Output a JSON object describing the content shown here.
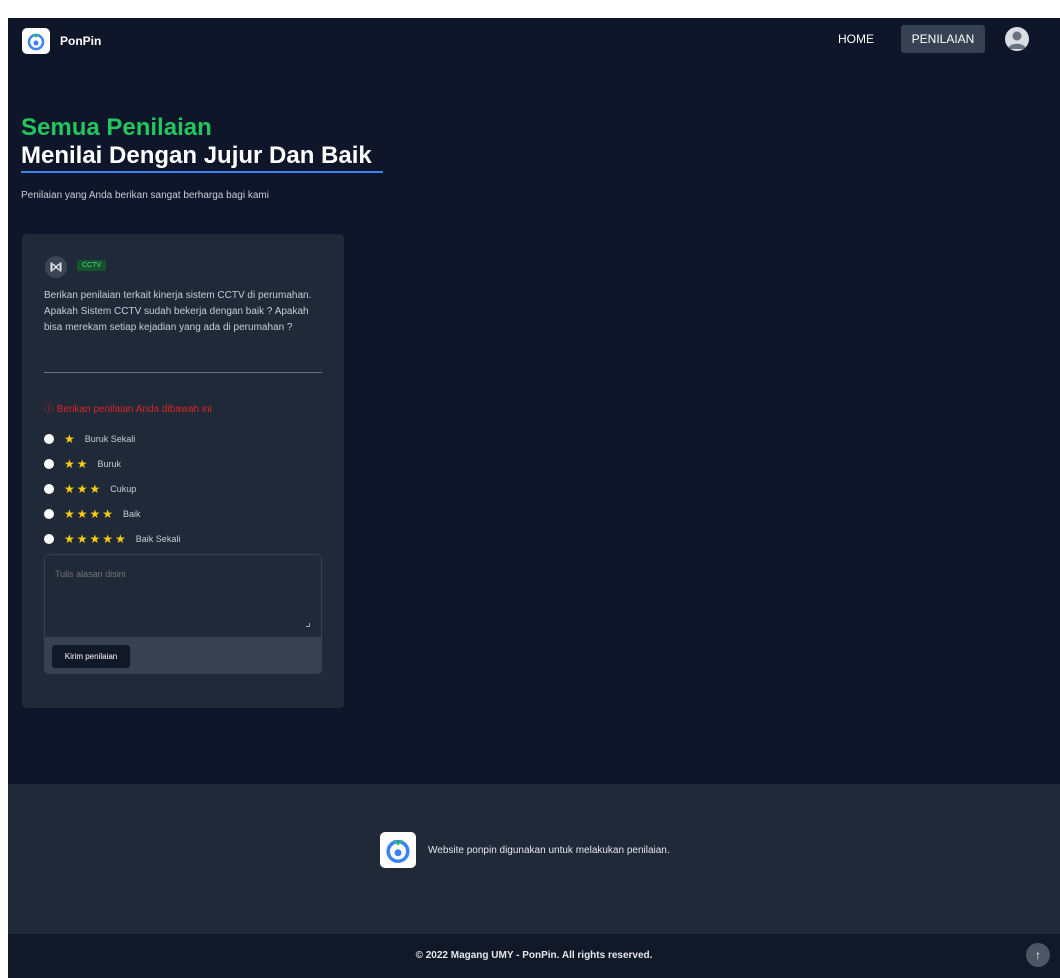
{
  "nav": {
    "brand": "PonPin",
    "home": "HOME",
    "penilaian": "PENILAIAN"
  },
  "hero": {
    "title": "Semua Penilaian",
    "subtitle": "Menilai Dengan Jujur Dan Baik",
    "description": "Penilaian yang Anda berikan sangat berharga bagi kami"
  },
  "card": {
    "badge": "CCTV",
    "question": "Berikan penilaian terkait kinerja sistem CCTV di perumahan. Apakah Sistem CCTV sudah bekerja dengan baik ? Apakah bisa merekam setiap kejadian yang ada di perumahan ?",
    "warning": "ⓘ Berikan penilaian Anda dibawah ini",
    "ratings": [
      {
        "stars": "★",
        "label": "Buruk Sekali"
      },
      {
        "stars": "★★",
        "label": "Buruk"
      },
      {
        "stars": "★★★",
        "label": "Cukup"
      },
      {
        "stars": "★★★★",
        "label": "Baik"
      },
      {
        "stars": "★★★★★",
        "label": "Baik Sekali"
      }
    ],
    "comment_placeholder": "Tulis alasan disini",
    "submit_label": "Kirim penilaian"
  },
  "footer": {
    "text": "Website ponpin digunakan untuk melakukan penilaian.",
    "copyright": "© 2022 Magang UMY - PonPin. All rights reserved."
  },
  "colors": {
    "background": "#0f1629",
    "accent_green": "#22c55e",
    "star_yellow": "#facc15",
    "warning_red": "#dc2626"
  }
}
